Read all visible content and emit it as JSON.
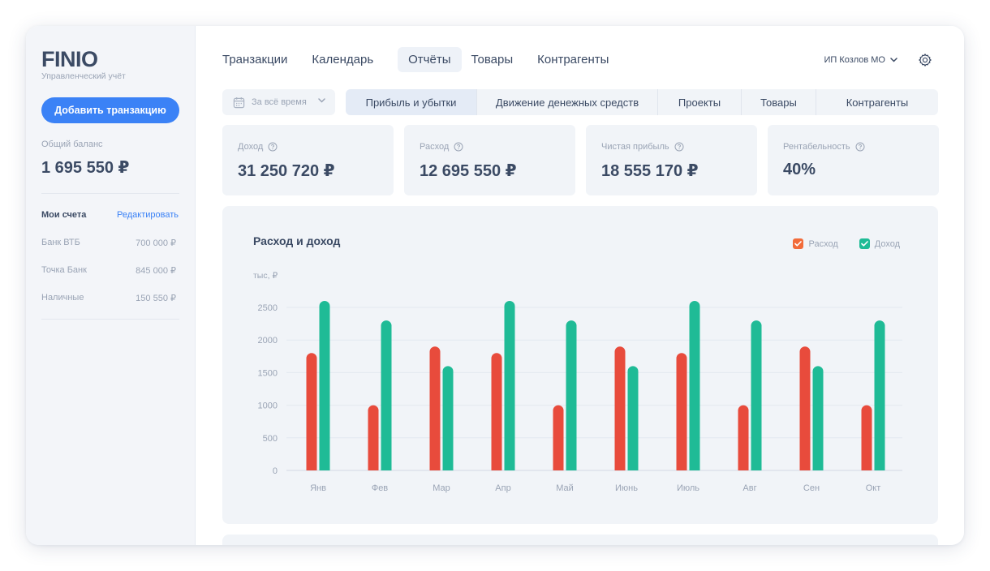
{
  "app": {
    "logo": "FINIO",
    "subtitle": "Управленческий учёт"
  },
  "sidebar": {
    "add_button": "Добавить транзакцию",
    "balance_label": "Общий баланс",
    "balance_value": "1 695 550 ₽",
    "accounts_title": "Мои счета",
    "edit_link": "Редактировать",
    "accounts": [
      {
        "name": "Банк ВТБ",
        "amount": "700 000 ₽"
      },
      {
        "name": "Точка Банк",
        "amount": "845 000 ₽"
      },
      {
        "name": "Наличные",
        "amount": "150 550 ₽"
      }
    ]
  },
  "nav": {
    "items": [
      "Транзакции",
      "Календарь",
      "Отчёты",
      "Товары",
      "Контрагенты"
    ],
    "active": "Отчёты",
    "org": "ИП Козлов МО"
  },
  "filters": {
    "period": "За всё время",
    "tabs": [
      "Прибыль и убытки",
      "Движение денежных средств",
      "Проекты",
      "Товары",
      "Контрагенты"
    ],
    "active_tab": "Прибыль и убытки"
  },
  "kpis": [
    {
      "label": "Доход",
      "value": "31 250 720 ₽"
    },
    {
      "label": "Расход",
      "value": "12 695 550 ₽"
    },
    {
      "label": "Чистая прибыль",
      "value": "18 555 170 ₽"
    },
    {
      "label": "Рентабельность",
      "value": "40%"
    }
  ],
  "colors": {
    "accent": "#3b82f6",
    "expense": "#e84b3c",
    "income": "#1fbb96",
    "legend_expense": "#f26b3a"
  },
  "chart_data": {
    "type": "bar",
    "title": "Расход и доход",
    "ylabel": "тыс, ₽",
    "xlabel": "",
    "ylim": [
      0,
      2500
    ],
    "yticks": [
      0,
      500,
      1000,
      1500,
      2000,
      2500
    ],
    "grid": true,
    "legend_position": "top-right",
    "categories": [
      "Янв",
      "Фев",
      "Мар",
      "Апр",
      "Май",
      "Июнь",
      "Июль",
      "Авг",
      "Сен",
      "Окт"
    ],
    "series": [
      {
        "name": "Расход",
        "values": [
          1800,
          1000,
          1900,
          1800,
          1000,
          1900,
          1800,
          1000,
          1900,
          1000
        ]
      },
      {
        "name": "Доход",
        "values": [
          2600,
          2300,
          1600,
          2600,
          2300,
          1600,
          2600,
          2300,
          1600,
          2300
        ]
      }
    ]
  }
}
